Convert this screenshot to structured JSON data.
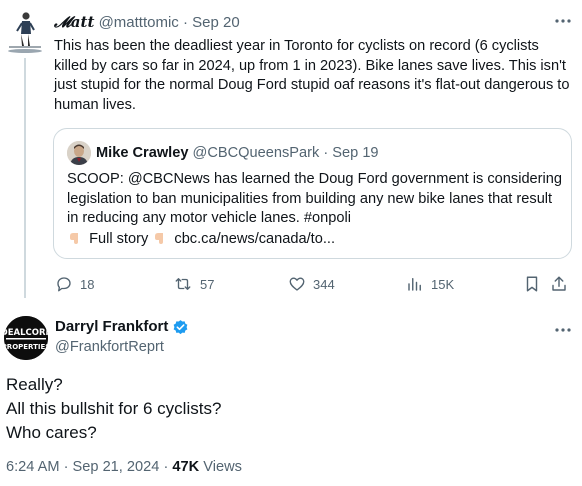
{
  "tweet1": {
    "name": "𝓜att",
    "handle": "@matttomic",
    "separator": "·",
    "date": "Sep 20",
    "text": "This has been the deadliest year in Toronto for cyclists on record (6 cyclists killed by cars so far in 2024, up from 1 in 2023). Bike lanes save lives. This isn't just stupid for the normal Doug Ford stupid oaf reasons it's flat-out dangerous to human lives.",
    "quote": {
      "name": "Mike Crawley",
      "handle": "@CBCQueensPark",
      "separator": "·",
      "date": "Sep 19",
      "text": "SCOOP: @CBCNews has learned the Doug Ford government is considering legislation to ban municipalities from building any new bike lanes that result in reducing any motor vehicle lanes. #onpoli",
      "full_story_label": "Full story",
      "link": "cbc.ca/news/canada/to..."
    },
    "actions": {
      "replies": "18",
      "retweets": "57",
      "likes": "344",
      "views": "15K"
    }
  },
  "tweet2": {
    "name": "Darryl Frankfort",
    "handle": "@FrankfortReprt",
    "avatar_text_top": "DEALCORE",
    "avatar_text_bottom": "PROPERTIES",
    "lines": [
      "Really?",
      "All this bullshit for 6 cyclists?",
      "Who cares?"
    ],
    "time": "6:24 AM",
    "separator": "·",
    "date": "Sep 21, 2024",
    "separator2": "·",
    "views_count": "47K",
    "views_label": "Views"
  },
  "icons": {
    "more": "more-icon",
    "reply": "reply-icon",
    "retweet": "retweet-icon",
    "like": "heart-icon",
    "views": "views-icon",
    "bookmark": "bookmark-icon",
    "share": "share-icon",
    "verified": "verified-badge-icon",
    "pointing_hand": "pointing-down-hand-icon"
  },
  "colors": {
    "text": "#0f1419",
    "muted": "#536471",
    "border": "#cfd9de",
    "verified": "#1d9bf0"
  }
}
